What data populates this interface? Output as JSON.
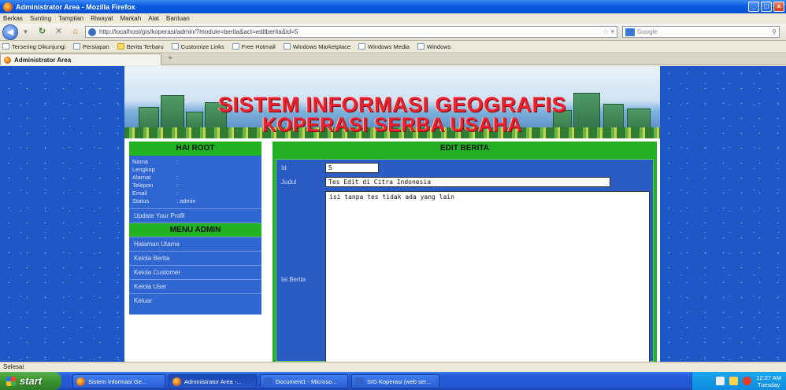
{
  "window": {
    "title": "Administrator Area - Mozilla Firefox",
    "buttons": [
      "minimize",
      "maximize",
      "close"
    ]
  },
  "menubar": [
    "Berkas",
    "Sunting",
    "Tampilan",
    "Riwayat",
    "Markah",
    "Alat",
    "Bantuan"
  ],
  "toolbar": {
    "url": "http://localhost/gis/koperasi/admin/?module=berita&act=editberita&id=5",
    "search_placeholder": "Google"
  },
  "bookmarks": [
    "Tersering Dikunjungi",
    "Persiapan",
    "Berita Terbaru",
    "Customize Links",
    "Free Hotmail",
    "Windows Marketplace",
    "Windows Media",
    "Windows"
  ],
  "tab": {
    "label": "Administrator Area"
  },
  "banner": {
    "line1": "SISTEM INFORMASI GEOGRAFIS",
    "line2": "KOPERASI SERBA USAHA"
  },
  "sidebar": {
    "greeting": "HAI ROOT",
    "profile": [
      {
        "k": "Nama Lengkap",
        "v": ":"
      },
      {
        "k": "Alamat",
        "v": ":"
      },
      {
        "k": "Telepon",
        "v": ":"
      },
      {
        "k": "Email",
        "v": ":"
      },
      {
        "k": "Status",
        "v": ": admin"
      }
    ],
    "update_profile": "Update Your Profil",
    "menu_title": "MENU ADMIN",
    "menu_items": [
      "Halaman Utama",
      "Kelola Berita",
      "Kelola Customer",
      "Kelola User",
      "Keluar"
    ]
  },
  "editor": {
    "title": "EDIT BERITA",
    "id_label": "Id",
    "id_value": "5",
    "judul_label": "Judul",
    "judul_value": "Tes Edit di Citra Indonesia",
    "isi_label": "Isi Berita",
    "isi_value": "isi tanpa tes tidak ada yang lain"
  },
  "statusbar": {
    "text": "Selesai"
  },
  "taskbar": {
    "start": "start",
    "tasks": [
      "Sistem Informasi Ge...",
      "Administrator Area -...",
      "Document1 - Microso...",
      "SIG Koperasi (web ser..."
    ],
    "clock_time": "12:27 AM",
    "clock_day": "Tuesday"
  },
  "colors": {
    "page_bg": "#1e58c6",
    "menu_green": "#22b022",
    "sidebar_blue": "#2f66d1",
    "banner_red": "#ec2030"
  }
}
